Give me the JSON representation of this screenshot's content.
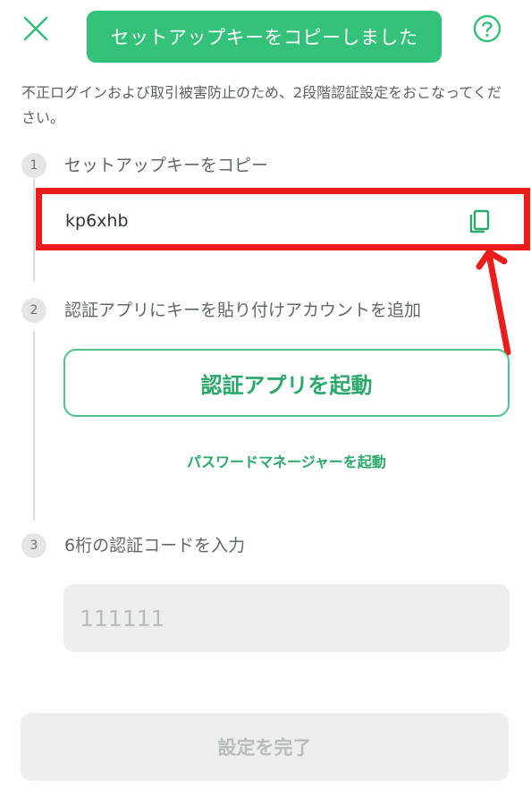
{
  "toast": {
    "message": "セットアップキーをコピーしました"
  },
  "intro": {
    "text": "不正ログインおよび取引被害防止のため、2段階認証設定をおこなってください。"
  },
  "steps": [
    {
      "number": "1",
      "title": "セットアップキーをコピー"
    },
    {
      "number": "2",
      "title": "認証アプリにキーを貼り付けアカウントを追加"
    },
    {
      "number": "3",
      "title": "6桁の認証コードを入力"
    }
  ],
  "setup_key": {
    "value": "kp6xhb"
  },
  "buttons": {
    "launch_app": "認証アプリを起動",
    "password_manager": "パスワードマネージャーを起動",
    "complete": "設定を完了"
  },
  "code_input": {
    "placeholder": "111111"
  },
  "colors": {
    "accent": "#34c17a",
    "accent_text": "#2aa86a",
    "highlight": "#ee1b1b",
    "disabled_bg": "#eceeed"
  },
  "icons": {
    "close": "close-icon",
    "help": "help-icon",
    "copy": "copy-icon"
  }
}
